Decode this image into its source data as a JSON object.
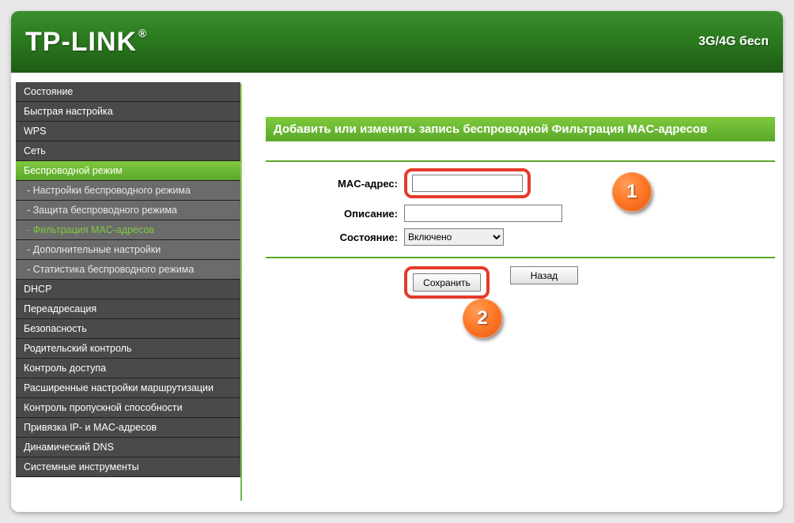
{
  "header": {
    "logo": "TP-LINK",
    "reg": "®",
    "right_text": "3G/4G бесп"
  },
  "sidebar": {
    "items": [
      {
        "label": "Состояние",
        "type": "main"
      },
      {
        "label": "Быстрая настройка",
        "type": "main"
      },
      {
        "label": "WPS",
        "type": "main"
      },
      {
        "label": "Сеть",
        "type": "main"
      },
      {
        "label": "Беспроводной режим",
        "type": "active"
      },
      {
        "label": "- Настройки беспроводного режима",
        "type": "sub"
      },
      {
        "label": "- Защита беспроводного режима",
        "type": "sub"
      },
      {
        "label": "- Фильтрация MAC-адресов",
        "type": "sub-active"
      },
      {
        "label": "- Дополнительные настройки",
        "type": "sub"
      },
      {
        "label": "- Статистика беспроводного режима",
        "type": "sub"
      },
      {
        "label": "DHCP",
        "type": "main"
      },
      {
        "label": "Переадресация",
        "type": "main"
      },
      {
        "label": "Безопасность",
        "type": "main"
      },
      {
        "label": "Родительский контроль",
        "type": "main"
      },
      {
        "label": "Контроль доступа",
        "type": "main"
      },
      {
        "label": "Расширенные настройки маршрутизации",
        "type": "main"
      },
      {
        "label": "Контроль пропускной способности",
        "type": "main"
      },
      {
        "label": "Привязка IP- и MAC-адресов",
        "type": "main"
      },
      {
        "label": "Динамический DNS",
        "type": "main"
      },
      {
        "label": "Системные инструменты",
        "type": "main"
      }
    ]
  },
  "page": {
    "title": "Добавить или изменить запись беспроводной Фильтрация MAC-адресов",
    "mac_label": "MAC-адрес:",
    "mac_value": "",
    "desc_label": "Описание:",
    "desc_value": "",
    "state_label": "Состояние:",
    "state_value": "Включено",
    "save_label": "Сохранить",
    "back_label": "Назад"
  },
  "callouts": {
    "one": "1",
    "two": "2"
  }
}
